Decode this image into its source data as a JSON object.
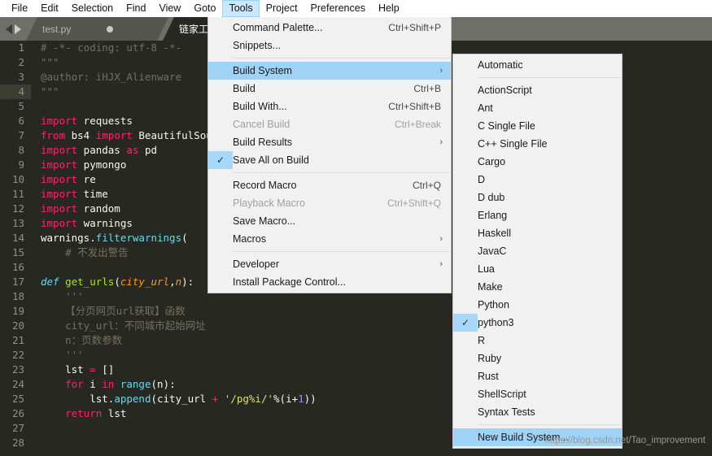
{
  "menubar": {
    "items": [
      {
        "label": "File"
      },
      {
        "label": "Edit"
      },
      {
        "label": "Selection"
      },
      {
        "label": "Find"
      },
      {
        "label": "View"
      },
      {
        "label": "Goto"
      },
      {
        "label": "Tools"
      },
      {
        "label": "Project"
      },
      {
        "label": "Preferences"
      },
      {
        "label": "Help"
      }
    ],
    "active_index": 6,
    "active_bg": "#cce8ff"
  },
  "tabbar": {
    "tabs": [
      {
        "label": "test.py",
        "modified": true
      },
      {
        "label": "链家工",
        "modified": false
      }
    ]
  },
  "tools_menu": {
    "items": [
      {
        "label": "Command Palette...",
        "accel": "Ctrl+Shift+P",
        "checked": false,
        "disabled": false,
        "arrow": false,
        "highlight": false
      },
      {
        "label": "Snippets...",
        "accel": "",
        "checked": false,
        "disabled": false,
        "arrow": false,
        "highlight": false
      },
      {
        "separator": true
      },
      {
        "label": "Build System",
        "accel": "",
        "checked": false,
        "disabled": false,
        "arrow": true,
        "highlight": true
      },
      {
        "label": "Build",
        "accel": "Ctrl+B",
        "checked": false,
        "disabled": false,
        "arrow": false,
        "highlight": false
      },
      {
        "label": "Build With...",
        "accel": "Ctrl+Shift+B",
        "checked": false,
        "disabled": false,
        "arrow": false,
        "highlight": false
      },
      {
        "label": "Cancel Build",
        "accel": "Ctrl+Break",
        "checked": false,
        "disabled": true,
        "arrow": false,
        "highlight": false
      },
      {
        "label": "Build Results",
        "accel": "",
        "checked": false,
        "disabled": false,
        "arrow": true,
        "highlight": false
      },
      {
        "label": "Save All on Build",
        "accel": "",
        "checked": true,
        "disabled": false,
        "arrow": false,
        "highlight": false
      },
      {
        "separator": true
      },
      {
        "label": "Record Macro",
        "accel": "Ctrl+Q",
        "checked": false,
        "disabled": false,
        "arrow": false,
        "highlight": false
      },
      {
        "label": "Playback Macro",
        "accel": "Ctrl+Shift+Q",
        "checked": false,
        "disabled": true,
        "arrow": false,
        "highlight": false
      },
      {
        "label": "Save Macro...",
        "accel": "",
        "checked": false,
        "disabled": false,
        "arrow": false,
        "highlight": false
      },
      {
        "label": "Macros",
        "accel": "",
        "checked": false,
        "disabled": false,
        "arrow": true,
        "highlight": false
      },
      {
        "separator": true
      },
      {
        "label": "Developer",
        "accel": "",
        "checked": false,
        "disabled": false,
        "arrow": true,
        "highlight": false
      },
      {
        "label": "Install Package Control...",
        "accel": "",
        "checked": false,
        "disabled": false,
        "arrow": false,
        "highlight": false
      }
    ]
  },
  "build_system_submenu": {
    "items": [
      {
        "label": "Automatic",
        "checked": false,
        "highlight": false
      },
      {
        "separator": true
      },
      {
        "label": "ActionScript",
        "checked": false,
        "highlight": false
      },
      {
        "label": "Ant",
        "checked": false,
        "highlight": false
      },
      {
        "label": "C Single File",
        "checked": false,
        "highlight": false
      },
      {
        "label": "C++ Single File",
        "checked": false,
        "highlight": false
      },
      {
        "label": "Cargo",
        "checked": false,
        "highlight": false
      },
      {
        "label": "D",
        "checked": false,
        "highlight": false
      },
      {
        "label": "D dub",
        "checked": false,
        "highlight": false
      },
      {
        "label": "Erlang",
        "checked": false,
        "highlight": false
      },
      {
        "label": "Haskell",
        "checked": false,
        "highlight": false
      },
      {
        "label": "JavaC",
        "checked": false,
        "highlight": false
      },
      {
        "label": "Lua",
        "checked": false,
        "highlight": false
      },
      {
        "label": "Make",
        "checked": false,
        "highlight": false
      },
      {
        "label": "Python",
        "checked": false,
        "highlight": false
      },
      {
        "label": "python3",
        "checked": true,
        "highlight": false
      },
      {
        "label": "R",
        "checked": false,
        "highlight": false
      },
      {
        "label": "Ruby",
        "checked": false,
        "highlight": false
      },
      {
        "label": "Rust",
        "checked": false,
        "highlight": false
      },
      {
        "label": "ShellScript",
        "checked": false,
        "highlight": false
      },
      {
        "label": "Syntax Tests",
        "checked": false,
        "highlight": false
      },
      {
        "separator": true
      },
      {
        "label": "New Build System...",
        "checked": false,
        "highlight": true
      }
    ]
  },
  "editor": {
    "current_line": 4,
    "lines": [
      {
        "n": 1,
        "tokens": [
          {
            "t": "# -*- coding: utf-8 -*-",
            "c": "k-comment"
          }
        ]
      },
      {
        "n": 2,
        "tokens": [
          {
            "t": "\"\"\"",
            "c": "k-comment"
          }
        ]
      },
      {
        "n": 3,
        "tokens": [
          {
            "t": "@author: iHJX_Alienware",
            "c": "k-comment"
          }
        ]
      },
      {
        "n": 4,
        "tokens": [
          {
            "t": "\"\"\"",
            "c": "k-comment"
          }
        ]
      },
      {
        "n": 5,
        "tokens": []
      },
      {
        "n": 6,
        "tokens": [
          {
            "t": "import",
            "c": "k-keyword"
          },
          {
            "t": " requests",
            "c": "k-name"
          }
        ]
      },
      {
        "n": 7,
        "tokens": [
          {
            "t": "from",
            "c": "k-keyword"
          },
          {
            "t": " bs4 ",
            "c": "k-name"
          },
          {
            "t": "import",
            "c": "k-keyword"
          },
          {
            "t": " BeautifulSoup",
            "c": "k-name"
          }
        ]
      },
      {
        "n": 8,
        "tokens": [
          {
            "t": "import",
            "c": "k-keyword"
          },
          {
            "t": " pandas ",
            "c": "k-name"
          },
          {
            "t": "as",
            "c": "k-keyword"
          },
          {
            "t": " pd",
            "c": "k-name"
          }
        ]
      },
      {
        "n": 9,
        "tokens": [
          {
            "t": "import",
            "c": "k-keyword"
          },
          {
            "t": " pymongo",
            "c": "k-name"
          }
        ]
      },
      {
        "n": 10,
        "tokens": [
          {
            "t": "import",
            "c": "k-keyword"
          },
          {
            "t": " re",
            "c": "k-name"
          }
        ]
      },
      {
        "n": 11,
        "tokens": [
          {
            "t": "import",
            "c": "k-keyword"
          },
          {
            "t": " time",
            "c": "k-name"
          }
        ]
      },
      {
        "n": 12,
        "tokens": [
          {
            "t": "import",
            "c": "k-keyword"
          },
          {
            "t": " random",
            "c": "k-name"
          }
        ]
      },
      {
        "n": 13,
        "tokens": [
          {
            "t": "import",
            "c": "k-keyword"
          },
          {
            "t": " warnings",
            "c": "k-name"
          }
        ]
      },
      {
        "n": 14,
        "tokens": [
          {
            "t": "warnings.",
            "c": "k-name"
          },
          {
            "t": "filterwarnings",
            "c": "k-func"
          },
          {
            "t": "(",
            "c": "k-name"
          }
        ]
      },
      {
        "n": 15,
        "tokens": [
          {
            "t": "    # 不发出警告",
            "c": "k-comment"
          }
        ]
      },
      {
        "n": 16,
        "tokens": []
      },
      {
        "n": 17,
        "tokens": [
          {
            "t": "def",
            "c": "k-def"
          },
          {
            "t": " ",
            "c": "k-name"
          },
          {
            "t": "get_urls",
            "c": "k-deffn"
          },
          {
            "t": "(",
            "c": "k-name"
          },
          {
            "t": "city_url",
            "c": "k-param"
          },
          {
            "t": ",",
            "c": "k-name"
          },
          {
            "t": "n",
            "c": "k-param"
          },
          {
            "t": "):",
            "c": "k-name"
          }
        ]
      },
      {
        "n": 18,
        "tokens": [
          {
            "t": "    '''",
            "c": "k-comment"
          }
        ]
      },
      {
        "n": 19,
        "tokens": [
          {
            "t": "    【分页网页url获取】函数",
            "c": "k-comment"
          }
        ]
      },
      {
        "n": 20,
        "tokens": [
          {
            "t": "    city_url：不同城市起始网址",
            "c": "k-comment"
          }
        ]
      },
      {
        "n": 21,
        "tokens": [
          {
            "t": "    n：页数参数",
            "c": "k-comment"
          }
        ]
      },
      {
        "n": 22,
        "tokens": [
          {
            "t": "    '''",
            "c": "k-comment"
          }
        ]
      },
      {
        "n": 23,
        "tokens": [
          {
            "t": "    lst ",
            "c": "k-name"
          },
          {
            "t": "= ",
            "c": "k-op"
          },
          {
            "t": "[]",
            "c": "k-name"
          }
        ]
      },
      {
        "n": 24,
        "tokens": [
          {
            "t": "    ",
            "c": "k-name"
          },
          {
            "t": "for",
            "c": "k-keyword"
          },
          {
            "t": " i ",
            "c": "k-name"
          },
          {
            "t": "in",
            "c": "k-keyword"
          },
          {
            "t": " ",
            "c": "k-name"
          },
          {
            "t": "range",
            "c": "k-func"
          },
          {
            "t": "(n):",
            "c": "k-name"
          }
        ]
      },
      {
        "n": 25,
        "tokens": [
          {
            "t": "        lst.",
            "c": "k-name"
          },
          {
            "t": "append",
            "c": "k-func"
          },
          {
            "t": "(city_url ",
            "c": "k-name"
          },
          {
            "t": "+ ",
            "c": "k-op"
          },
          {
            "t": "'/pg%i/'",
            "c": "k-str"
          },
          {
            "t": "%(i+",
            "c": "k-name"
          },
          {
            "t": "1",
            "c": "k-num"
          },
          {
            "t": "))",
            "c": "k-name"
          }
        ]
      },
      {
        "n": 26,
        "tokens": [
          {
            "t": "    ",
            "c": "k-name"
          },
          {
            "t": "return",
            "c": "k-keyword"
          },
          {
            "t": " lst",
            "c": "k-name"
          }
        ]
      },
      {
        "n": 27,
        "tokens": []
      },
      {
        "n": 28,
        "tokens": []
      }
    ]
  },
  "watermark": {
    "text": "https://blog.csdn.net/Tao_improvement"
  }
}
